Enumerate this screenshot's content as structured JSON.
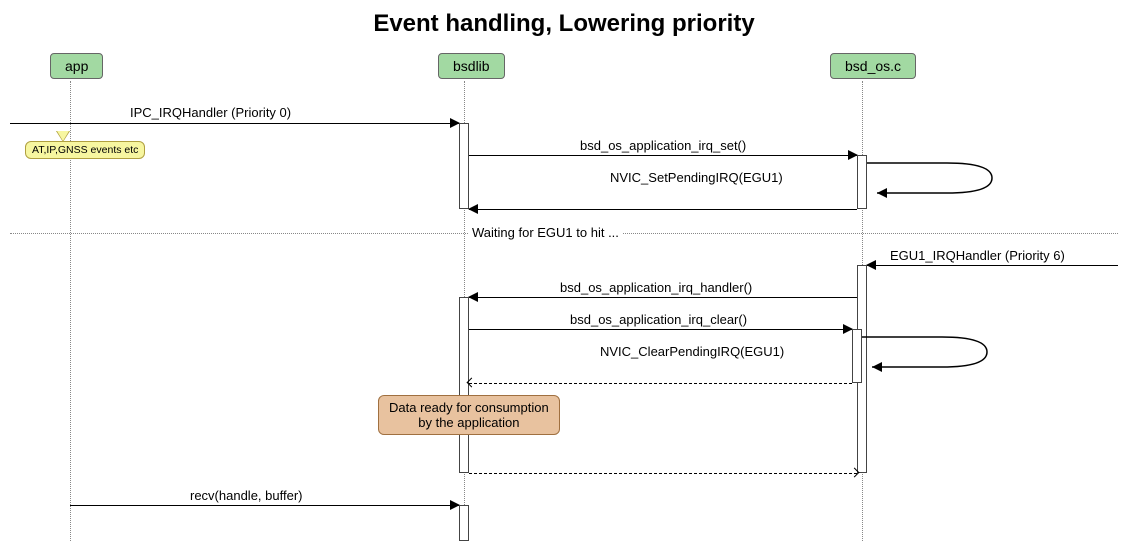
{
  "title": "Event handling, Lowering priority",
  "participants": {
    "app": "app",
    "bsdlib": "bsdlib",
    "bsd_os": "bsd_os.c"
  },
  "messages": {
    "ipc_irq": "IPC_IRQHandler (Priority 0)",
    "note_events": "AT,IP,GNSS events etc",
    "irq_set": "bsd_os_application_irq_set()",
    "nvic_set": "NVIC_SetPendingIRQ(EGU1)",
    "divider": "Waiting for EGU1 to hit ...",
    "egu1_irq": "EGU1_IRQHandler (Priority 6)",
    "irq_handler": "bsd_os_application_irq_handler()",
    "irq_clear": "bsd_os_application_irq_clear()",
    "nvic_clear": "NVIC_ClearPendingIRQ(EGU1)",
    "note_data": "Data ready for consumption\nby the application",
    "recv": "recv(handle, buffer)"
  }
}
